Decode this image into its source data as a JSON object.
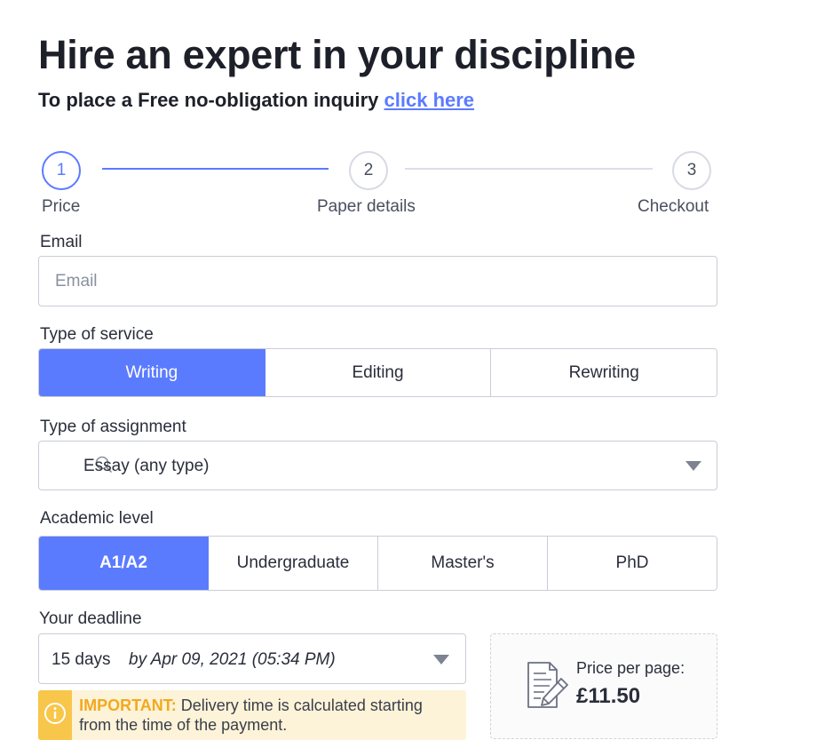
{
  "header": {
    "title": "Hire an expert in your discipline",
    "subtitle_prefix": "To place a Free no-obligation inquiry",
    "subtitle_link": "click here"
  },
  "steps": [
    {
      "number": "1",
      "label": "Price",
      "active": true
    },
    {
      "number": "2",
      "label": "Paper details",
      "active": false
    },
    {
      "number": "3",
      "label": "Checkout",
      "active": false
    }
  ],
  "email": {
    "label": "Email",
    "value": "",
    "placeholder": "Email"
  },
  "service": {
    "label": "Type of service",
    "options": [
      "Writing",
      "Editing",
      "Rewriting"
    ],
    "selected": "Writing"
  },
  "assignment": {
    "label": "Type of assignment",
    "value": "Essay (any type)"
  },
  "academic": {
    "label": "Academic level",
    "options": [
      "A1/A2",
      "Undergraduate",
      "Master's",
      "PhD"
    ],
    "selected": "A1/A2"
  },
  "deadline": {
    "label": "Your deadline",
    "value": "15 days",
    "date": "by Apr 09, 2021 (05:34 PM)"
  },
  "notice": {
    "important": "IMPORTANT:",
    "text": "Delivery time is calculated starting from the time of the payment."
  },
  "price": {
    "label": "Price per page:",
    "value": "£11.50"
  },
  "colors": {
    "accent": "#5b7bff",
    "warning": "#f8c64a",
    "warning_bg": "#fdf3d8"
  }
}
